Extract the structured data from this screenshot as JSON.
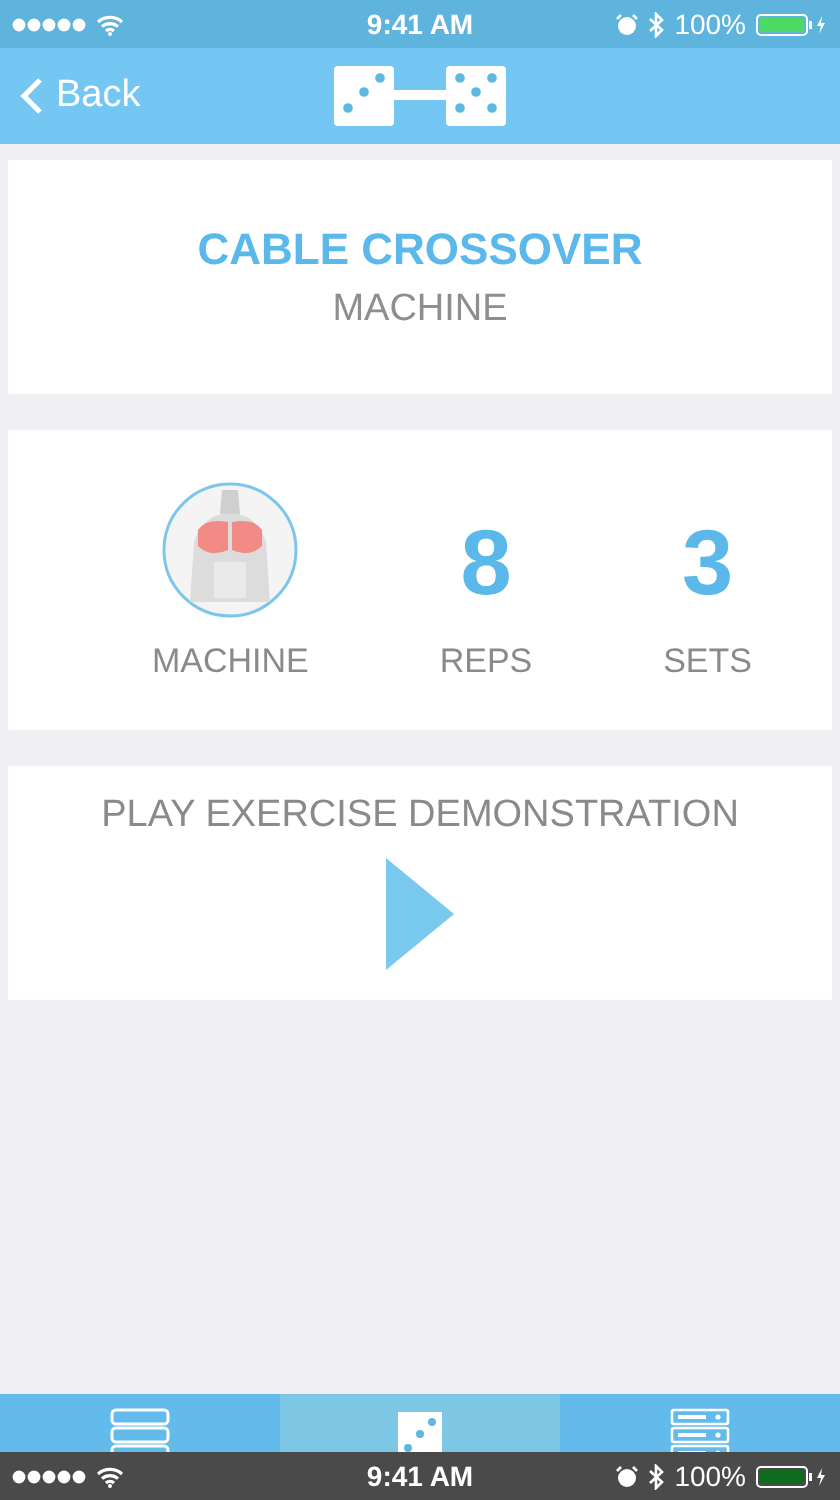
{
  "status_bar": {
    "kind": "light",
    "time": "9:41 AM",
    "battery": "100%"
  },
  "nav_bar": {
    "back": "Back"
  },
  "exercise": {
    "name": "CABLE CROSSOVER",
    "equipment": "MACHINE"
  },
  "stats": [
    {
      "kind": "figure",
      "label": "MACHINE"
    },
    {
      "kind": "number",
      "value": "8",
      "label": "REPS"
    },
    {
      "kind": "number",
      "value": "3",
      "label": "SETS"
    }
  ],
  "demo": {
    "label": "PLAY EXERCISE DEMONSTRATION"
  },
  "tabs": [
    {
      "kind": "list",
      "selected": false
    },
    {
      "kind": "dice",
      "selected": true
    },
    {
      "kind": "rack",
      "selected": false
    }
  ],
  "bottom_status_bar": {
    "kind": "dark",
    "time": "9:41 AM",
    "battery": "100%"
  }
}
